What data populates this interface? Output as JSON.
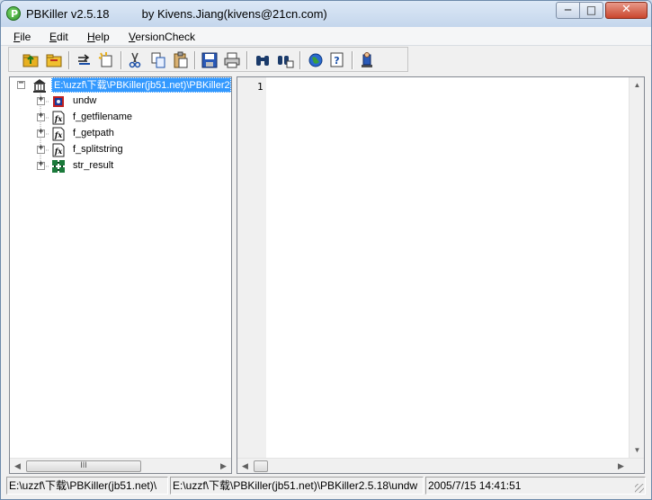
{
  "window": {
    "title": "PBKiller v2.5.18          by Kivens.Jiang(kivens@21cn.com)",
    "minimize_glyph": "─",
    "maximize_glyph": "□",
    "close_glyph": "✕"
  },
  "menu": {
    "items": [
      {
        "label": "File",
        "key": "F"
      },
      {
        "label": "Edit",
        "key": "E"
      },
      {
        "label": "Help",
        "key": "H"
      },
      {
        "label": "VersionCheck",
        "key": "V"
      }
    ]
  },
  "toolbar": {
    "buttons": [
      {
        "name": "open-icon",
        "glyph": "📂"
      },
      {
        "name": "open-folder-icon",
        "glyph": "📁"
      },
      {
        "name": "export-icon",
        "glyph": "⇉"
      },
      {
        "name": "import-icon",
        "glyph": "✚"
      },
      {
        "name": "cut-icon",
        "glyph": "✂"
      },
      {
        "name": "copy-icon",
        "glyph": "❐"
      },
      {
        "name": "paste-icon",
        "glyph": "📋"
      },
      {
        "name": "save-icon",
        "glyph": "💾"
      },
      {
        "name": "print-icon",
        "glyph": "🖶"
      },
      {
        "name": "find-icon",
        "glyph": "🔍"
      },
      {
        "name": "find-next-icon",
        "glyph": "⌕"
      },
      {
        "name": "web-icon",
        "glyph": "🌐"
      },
      {
        "name": "help-icon",
        "glyph": "?"
      },
      {
        "name": "exit-icon",
        "glyph": "⛩"
      }
    ],
    "colors": {
      "accent": "#1a4fa8",
      "yellow": "#e8b020"
    }
  },
  "tree": {
    "root": {
      "label": "E:\\uzzf\\下载\\PBKiller(jb51.net)\\PBKiller2",
      "icon": "library-icon",
      "expander": "−"
    },
    "children": [
      {
        "label": "undw",
        "icon": "datawindow-icon",
        "expander": "+"
      },
      {
        "label": "f_getfilename",
        "icon": "function-icon",
        "expander": "+"
      },
      {
        "label": "f_getpath",
        "icon": "function-icon",
        "expander": "+"
      },
      {
        "label": "f_splitstring",
        "icon": "function-icon",
        "expander": "+"
      },
      {
        "label": "str_result",
        "icon": "structure-icon",
        "expander": "+"
      }
    ],
    "selection_color": "#3399ff",
    "scrollbar": {
      "left": "◀",
      "right": "▶",
      "grip": "III"
    }
  },
  "editor": {
    "line_number": "1",
    "scrollbar": {
      "up": "▲",
      "down": "▼",
      "left": "◀",
      "right": "▶"
    }
  },
  "status": {
    "path1": "E:\\uzzf\\下载\\PBKiller(jb51.net)\\",
    "path2": "E:\\uzzf\\下载\\PBKiller(jb51.net)\\PBKiller2.5.18\\undw",
    "datetime": "2005/7/15 14:41:51"
  }
}
